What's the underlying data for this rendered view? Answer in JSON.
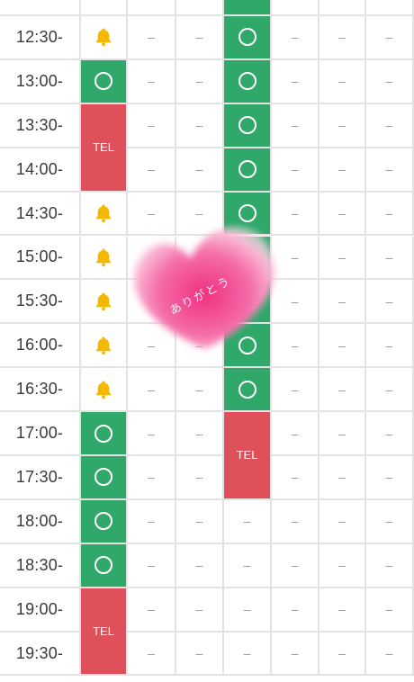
{
  "schedule": {
    "columns": 8,
    "rows": [
      {
        "time": "12:30-",
        "cells": [
          "bell",
          "dash",
          "dash",
          "circle",
          "dash",
          "dash",
          "dash"
        ]
      },
      {
        "time": "13:00-",
        "cells": [
          "circle",
          "dash",
          "dash",
          "circle",
          "dash",
          "dash",
          "dash"
        ]
      },
      {
        "time": "13:30-",
        "cells": [
          "tel",
          "dash",
          "dash",
          "circle",
          "dash",
          "dash",
          "dash"
        ]
      },
      {
        "time": "14:00-",
        "cells": [
          "tel",
          "dash",
          "dash",
          "circle",
          "dash",
          "dash",
          "dash"
        ]
      },
      {
        "time": "14:30-",
        "cells": [
          "bell",
          "dash",
          "dash",
          "circle",
          "dash",
          "dash",
          "dash"
        ]
      },
      {
        "time": "15:00-",
        "cells": [
          "bell",
          "dash",
          "dash",
          "circle",
          "dash",
          "dash",
          "dash"
        ]
      },
      {
        "time": "15:30-",
        "cells": [
          "bell",
          "dash",
          "dash",
          "circle",
          "dash",
          "dash",
          "dash"
        ]
      },
      {
        "time": "16:00-",
        "cells": [
          "bell",
          "dash",
          "dash",
          "circle",
          "dash",
          "dash",
          "dash"
        ]
      },
      {
        "time": "16:30-",
        "cells": [
          "bell",
          "dash",
          "dash",
          "circle",
          "dash",
          "dash",
          "dash"
        ]
      },
      {
        "time": "17:00-",
        "cells": [
          "circle",
          "dash",
          "dash",
          "tel",
          "dash",
          "dash",
          "dash"
        ]
      },
      {
        "time": "17:30-",
        "cells": [
          "circle",
          "dash",
          "dash",
          "tel",
          "dash",
          "dash",
          "dash"
        ]
      },
      {
        "time": "18:00-",
        "cells": [
          "circle",
          "dash",
          "dash",
          "dash",
          "dash",
          "dash",
          "dash"
        ]
      },
      {
        "time": "18:30-",
        "cells": [
          "circle",
          "dash",
          "dash",
          "dash",
          "dash",
          "dash",
          "dash"
        ]
      },
      {
        "time": "19:00-",
        "cells": [
          "tel",
          "dash",
          "dash",
          "dash",
          "dash",
          "dash",
          "dash"
        ]
      },
      {
        "time": "19:30-",
        "cells": [
          "tel",
          "dash",
          "dash",
          "dash",
          "dash",
          "dash",
          "dash"
        ]
      }
    ],
    "tel_label": "TEL",
    "dash_symbol": "–"
  },
  "overlay": {
    "heart_text": "ありがとう"
  },
  "colors": {
    "available": "#2fa86a",
    "tel": "#e0505a",
    "bell": "#f5b800",
    "heart": "#f0529a"
  }
}
